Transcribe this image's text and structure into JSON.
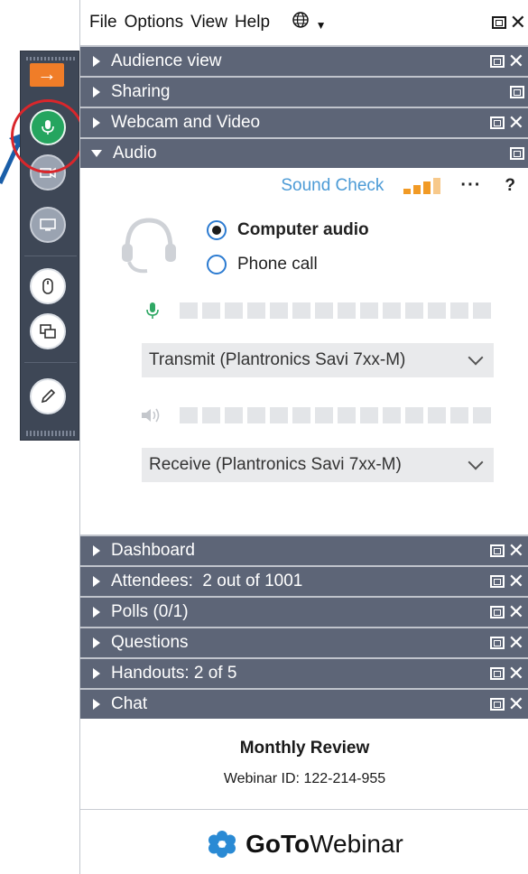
{
  "menu": {
    "file": "File",
    "options": "Options",
    "view": "View",
    "help": "Help",
    "globe_icon": "globe-icon"
  },
  "toolbar": {
    "collapse_arrow": "→"
  },
  "sections_top": [
    {
      "label": "Audience view"
    },
    {
      "label": "Sharing"
    },
    {
      "label": "Webcam and Video"
    },
    {
      "label": "Audio"
    }
  ],
  "audio": {
    "sound_check": "Sound Check",
    "more": "···",
    "help": "?",
    "computer_audio": "Computer audio",
    "phone_call": "Phone call",
    "selected": "Computer audio",
    "transmit_device": "Transmit (Plantronics Savi 7xx-M)",
    "receive_device": "Receive (Plantronics Savi 7xx-M)",
    "sound_check_level": 0.75
  },
  "sections_bottom": [
    {
      "label": "Dashboard"
    },
    {
      "label": "Attendees:  2 out of 1001"
    },
    {
      "label": "Polls (0/1)"
    },
    {
      "label": "Questions"
    },
    {
      "label": "Handouts: 2 of 5"
    },
    {
      "label": "Chat"
    }
  ],
  "footer": {
    "webinar_title": "Monthly Review",
    "webinar_id": "Webinar ID: 122-214-955",
    "brand_bold": "GoTo",
    "brand_regular": "Webinar"
  },
  "colors": {
    "section_bg": "#5d6577",
    "accent_orange": "#f07d28",
    "mic_green": "#25a55f",
    "link_blue": "#4c9bd6",
    "annotation_red": "#d9262b"
  }
}
